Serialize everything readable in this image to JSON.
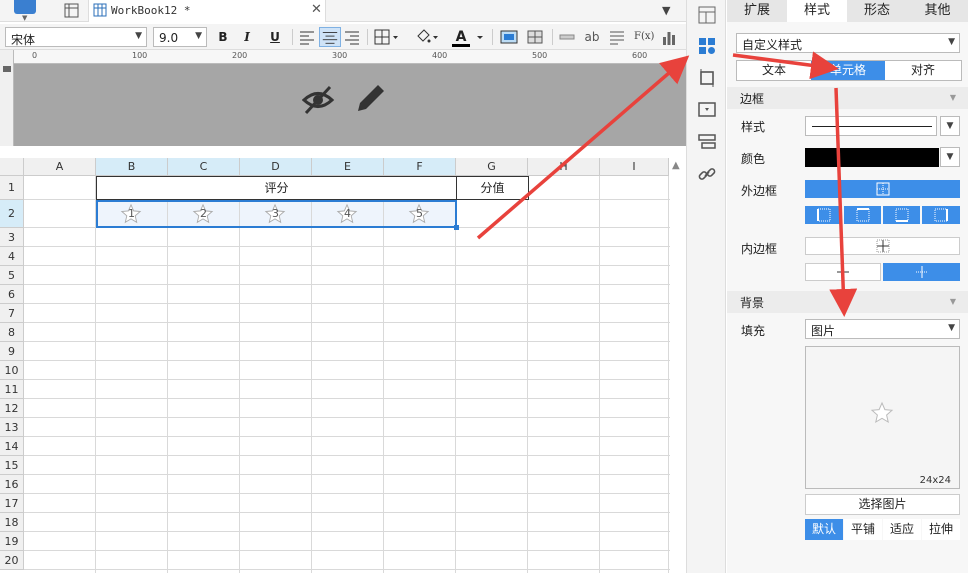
{
  "tabs": {
    "workbook_title": "WorkBook12 *",
    "close": "✕"
  },
  "toolbar": {
    "font_name": "宋体",
    "font_size": "9.0",
    "bold": "B",
    "italic": "I",
    "underline": "U",
    "font_color_label": "A",
    "ab_label": "ab",
    "formula_label": "F(x)"
  },
  "ruler": {
    "marks": [
      "0",
      "100",
      "200",
      "300",
      "400",
      "500",
      "600"
    ]
  },
  "grid": {
    "columns": [
      "A",
      "B",
      "C",
      "D",
      "E",
      "F",
      "G",
      "H",
      "I"
    ],
    "rows": [
      "1",
      "2",
      "3",
      "4",
      "5",
      "6",
      "7",
      "8",
      "9",
      "10",
      "11",
      "12",
      "13",
      "14",
      "15",
      "16",
      "17",
      "18",
      "19",
      "20"
    ],
    "merged_header": "评分",
    "g1": "分值",
    "stars": [
      "1",
      "2",
      "3",
      "4",
      "5"
    ]
  },
  "panel": {
    "tabs": [
      "扩展",
      "样式",
      "形态",
      "其他"
    ],
    "active_tab": "样式",
    "style_select": "自定义样式",
    "subtabs": [
      "文本",
      "单元格",
      "对齐"
    ],
    "active_subtab": "单元格",
    "border_section": "边框",
    "style_label": "样式",
    "color_label": "颜色",
    "outer_border_label": "外边框",
    "inner_border_label": "内边框",
    "background_section": "背景",
    "fill_label": "填充",
    "fill_value": "图片",
    "image_size": "24x24",
    "choose_image": "选择图片",
    "modes": [
      "默认",
      "平铺",
      "适应",
      "拉伸"
    ],
    "active_mode": "默认",
    "border_color": "#000000"
  },
  "colors": {
    "accent": "#3d8ee8",
    "selection": "#2b7cd3",
    "arrow": "#e8423c"
  }
}
